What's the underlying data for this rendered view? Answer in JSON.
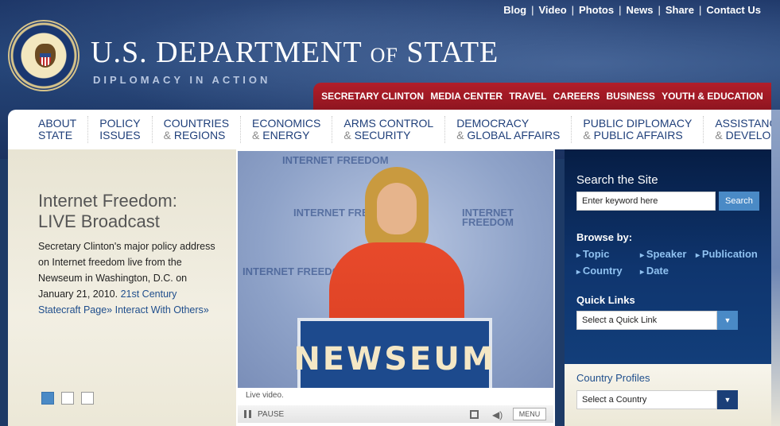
{
  "header": {
    "title_main": "U.S. DEPARTMENT",
    "title_of": "OF",
    "title_state": "STATE",
    "tagline": "DIPLOMACY IN ACTION",
    "seal_text": "DEPARTMENT OF STATE · UNITED STATES OF AMERICA"
  },
  "top_links": [
    "Blog",
    "Video",
    "Photos",
    "News",
    "Share",
    "Contact Us"
  ],
  "red_nav": [
    "SECRETARY CLINTON",
    "MEDIA CENTER",
    "TRAVEL",
    "CAREERS",
    "BUSINESS",
    "YOUTH & EDUCATION"
  ],
  "main_nav": [
    {
      "l1": "ABOUT",
      "l2": "STATE"
    },
    {
      "l1": "POLICY",
      "l2": "ISSUES"
    },
    {
      "l1": "COUNTRIES",
      "amp": "&",
      "l2": "REGIONS"
    },
    {
      "l1": "ECONOMICS",
      "amp": "&",
      "l2": "ENERGY"
    },
    {
      "l1": "ARMS CONTROL",
      "amp": "&",
      "l2": "SECURITY"
    },
    {
      "l1": "DEMOCRACY",
      "amp": "&",
      "l2": "GLOBAL AFFAIRS"
    },
    {
      "l1": "PUBLIC DIPLOMACY",
      "amp": "&",
      "l2": "PUBLIC AFFAIRS"
    },
    {
      "l1": "ASSISTANCE",
      "amp": "&",
      "l2": "DEVELOPMENT"
    }
  ],
  "feature": {
    "title_line1": "Internet Freedom:",
    "title_line2": "LIVE Broadcast",
    "body": "Secretary Clinton's major policy address on Internet freedom live from the Newseum in Washington, D.C. on January 21, 2010.",
    "link1": "21st Century Statecraft Page»",
    "link2": "Interact With Others»",
    "pager_active": 1,
    "pager_count": 3
  },
  "video": {
    "podium_text": "NEWSEUM",
    "bg_logo": "INTERNET FREEDOM",
    "caption": "Live video.",
    "pause_label": "PAUSE",
    "menu_label": "MENU"
  },
  "sidebar": {
    "search_title": "Search the Site",
    "search_placeholder": "Enter keyword here",
    "search_button": "Search",
    "browse_title": "Browse by:",
    "browse_items": [
      "Topic",
      "Speaker",
      "Publication",
      "Country",
      "Date"
    ],
    "quick_links_title": "Quick Links",
    "quick_links_select": "Select a Quick Link",
    "country_profiles_title": "Country Profiles",
    "country_select": "Select a Country"
  },
  "colors": {
    "red_nav": "#b21e2a",
    "nav_text": "#1f3f7a",
    "link_blue": "#1f4e8c",
    "accent_blue": "#4a8ac6"
  }
}
